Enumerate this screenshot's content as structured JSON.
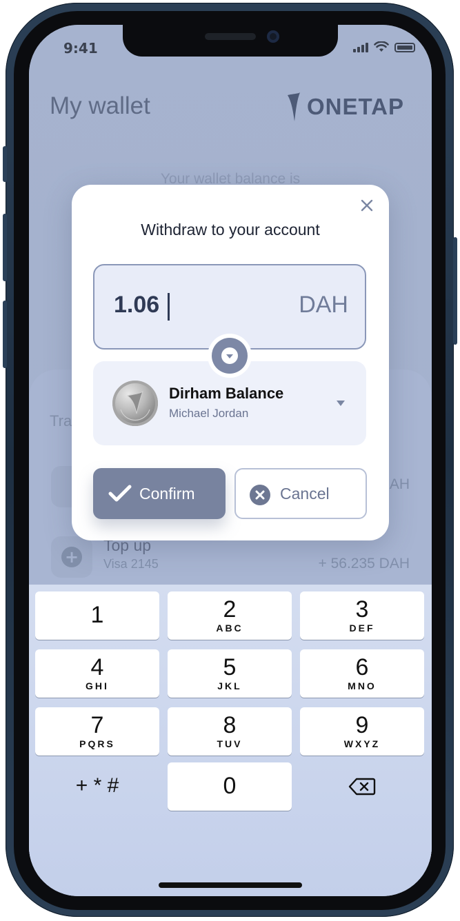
{
  "status_bar": {
    "time": "9:41"
  },
  "app": {
    "title": "My wallet",
    "brand": "ONETAP",
    "balance_caption": "Your wallet balance is",
    "section_title": "Tra",
    "transactions": [
      {
        "title": "",
        "subtitle": "",
        "amount": "AH",
        "icon": "minus-circle-icon"
      },
      {
        "title": "Top up",
        "subtitle": "Visa 2145",
        "amount": "+ 56.235  DAH",
        "icon": "plus-circle-icon"
      }
    ]
  },
  "modal": {
    "title": "Withdraw to your account",
    "amount": "1.06",
    "currency": "DAH",
    "account": {
      "name": "Dirham Balance",
      "holder": "Michael Jordan"
    },
    "confirm_label": "Confirm",
    "cancel_label": "Cancel"
  },
  "keypad": {
    "keys": [
      {
        "digit": "1",
        "letters": ""
      },
      {
        "digit": "2",
        "letters": "ABC"
      },
      {
        "digit": "3",
        "letters": "DEF"
      },
      {
        "digit": "4",
        "letters": "GHI"
      },
      {
        "digit": "5",
        "letters": "JKL"
      },
      {
        "digit": "6",
        "letters": "MNO"
      },
      {
        "digit": "7",
        "letters": "PQRS"
      },
      {
        "digit": "8",
        "letters": "TUV"
      },
      {
        "digit": "9",
        "letters": "WXYZ"
      },
      {
        "digit": "0",
        "letters": ""
      }
    ],
    "symbols_label": "+ * #",
    "delete_icon": "backspace-icon"
  },
  "colors": {
    "accent": "#78839f",
    "overlay": "#a6b3cf",
    "field_border": "#8a97b8"
  }
}
